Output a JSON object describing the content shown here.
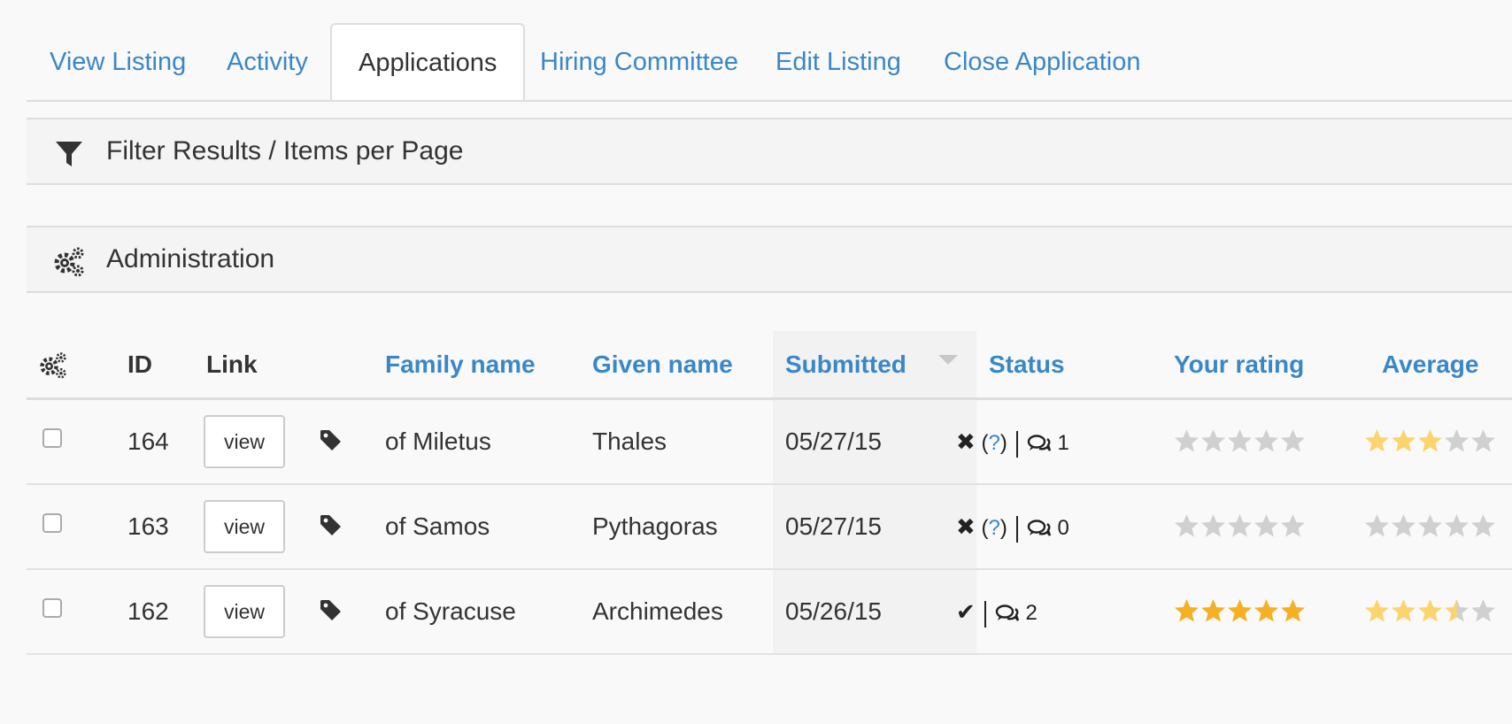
{
  "tabs": [
    {
      "label": "View Listing",
      "active": false
    },
    {
      "label": "Activity",
      "active": false
    },
    {
      "label": "Applications",
      "active": true
    },
    {
      "label": "Hiring Committee",
      "active": false
    },
    {
      "label": "Edit Listing",
      "active": false
    },
    {
      "label": "Close Application",
      "active": false
    }
  ],
  "panels": {
    "filter": {
      "label": "Filter Results / Items per Page",
      "icon": "filter-icon"
    },
    "admin": {
      "label": "Administration",
      "icon": "gears-icon"
    }
  },
  "table": {
    "headers": {
      "id": "ID",
      "link": "Link",
      "family": "Family name",
      "given": "Given name",
      "submitted": "Submitted",
      "status": "Status",
      "your_rating": "Your rating",
      "average": "Average"
    },
    "view_label": "view",
    "rows": [
      {
        "id": "164",
        "family": "of Miletus",
        "given": "Thales",
        "submitted": "05/27/15",
        "status_icon": "x-icon",
        "status_mark": "✖",
        "has_question": true,
        "question": "?",
        "comments": "1",
        "your_rating": 0,
        "average": 3
      },
      {
        "id": "163",
        "family": "of Samos",
        "given": "Pythagoras",
        "submitted": "05/27/15",
        "status_icon": "x-icon",
        "status_mark": "✖",
        "has_question": true,
        "question": "?",
        "comments": "0",
        "your_rating": 0,
        "average": 0
      },
      {
        "id": "162",
        "family": "of Syracuse",
        "given": "Archimedes",
        "submitted": "05/26/15",
        "status_icon": "check-icon",
        "status_mark": "✔",
        "has_question": false,
        "question": "",
        "comments": "2",
        "your_rating": 5,
        "average": 3.5
      }
    ]
  },
  "colors": {
    "link": "#3a87c8",
    "star_full": "#f5b021",
    "star_avg": "#fbd46d",
    "star_empty": "#d0d0d0"
  }
}
